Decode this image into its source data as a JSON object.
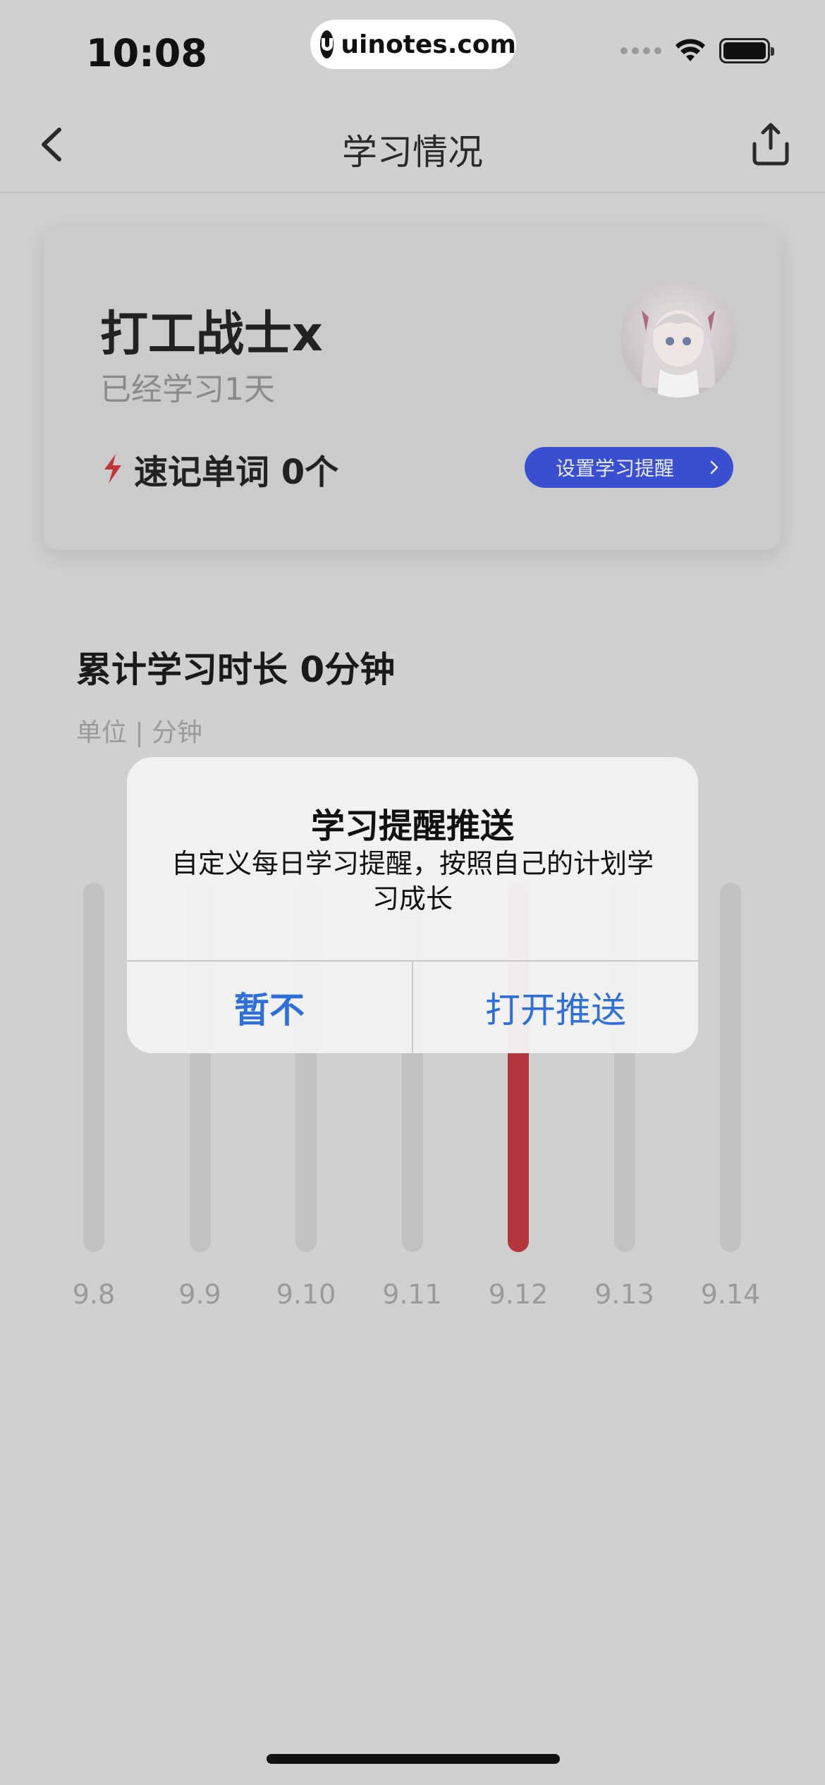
{
  "status_bar": {
    "time": "10:08",
    "url": "uinotes.com"
  },
  "nav": {
    "title": "学习情况",
    "back_icon": "chevron-left-icon",
    "share_icon": "share-icon"
  },
  "profile": {
    "name": "打工战士x",
    "study_days": "已经学习1天",
    "words_label": "速记单词 0个",
    "reminder_button": "设置学习提醒"
  },
  "stats": {
    "title": "累计学习时长 0分钟",
    "unit": "单位 | 分钟"
  },
  "chart_data": {
    "type": "bar",
    "categories": [
      "9.8",
      "9.9",
      "9.10",
      "9.11",
      "9.12",
      "9.13",
      "9.14"
    ],
    "values": [
      0,
      0,
      0,
      0,
      0,
      0,
      0
    ],
    "highlighted": "9.12",
    "colors": {
      "track": "#c2c2c2",
      "highlight": "#b3373d"
    }
  },
  "dialog": {
    "title": "学习提醒推送",
    "message": "自定义每日学习提醒，按照自己的计划学习成长",
    "cancel": "暂不",
    "confirm": "打开推送"
  },
  "colors": {
    "accent_blue": "#3a4fd0",
    "dialog_button": "#2f6fd8",
    "bolt_red": "#c0343b"
  }
}
